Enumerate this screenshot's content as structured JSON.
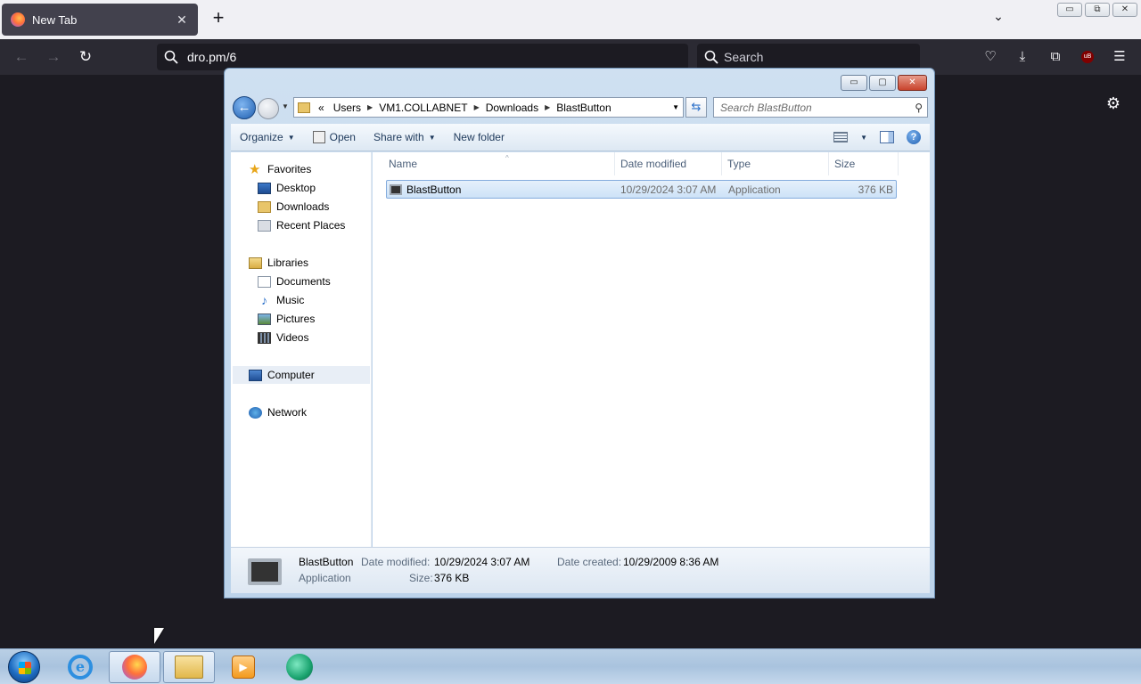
{
  "browser": {
    "tab": {
      "title": "New Tab",
      "close": "✕"
    },
    "new_tab": "+",
    "url": "dro.pm/6",
    "search_placeholder": "Search",
    "window_controls": [
      "▭",
      "⧉",
      "✕"
    ],
    "icons": [
      "pocket-icon",
      "download-icon",
      "extensions-icon",
      "ublock-icon",
      "menu-icon",
      "settings-icon"
    ],
    "ublock_label": "uB"
  },
  "explorer": {
    "breadcrumb": [
      "«",
      "Users",
      "VM1.COLLABNET",
      "Downloads",
      "BlastButton"
    ],
    "search_placeholder": "Search BlastButton",
    "toolbar": {
      "organize": "Organize",
      "open": "Open",
      "share_with": "Share with",
      "new_folder": "New folder"
    },
    "nav": {
      "favorites": "Favorites",
      "desktop": "Desktop",
      "downloads": "Downloads",
      "recent_places": "Recent Places",
      "libraries": "Libraries",
      "documents": "Documents",
      "music": "Music",
      "pictures": "Pictures",
      "videos": "Videos",
      "computer": "Computer",
      "network": "Network"
    },
    "columns": {
      "name": "Name",
      "date_modified": "Date modified",
      "type": "Type",
      "size": "Size"
    },
    "files": [
      {
        "name": "BlastButton",
        "date_modified": "10/29/2024 3:07 AM",
        "type": "Application",
        "size": "376 KB"
      }
    ],
    "details": {
      "name": "BlastButton",
      "type": "Application",
      "date_modified_label": "Date modified:",
      "date_modified": "10/29/2024 3:07 AM",
      "size_label": "Size:",
      "size": "376 KB",
      "date_created_label": "Date created:",
      "date_created": "10/29/2009 8:36 AM"
    }
  },
  "taskbar": {
    "apps": [
      "internet-explorer",
      "firefox",
      "windows-explorer",
      "media-player",
      "green-app"
    ]
  }
}
